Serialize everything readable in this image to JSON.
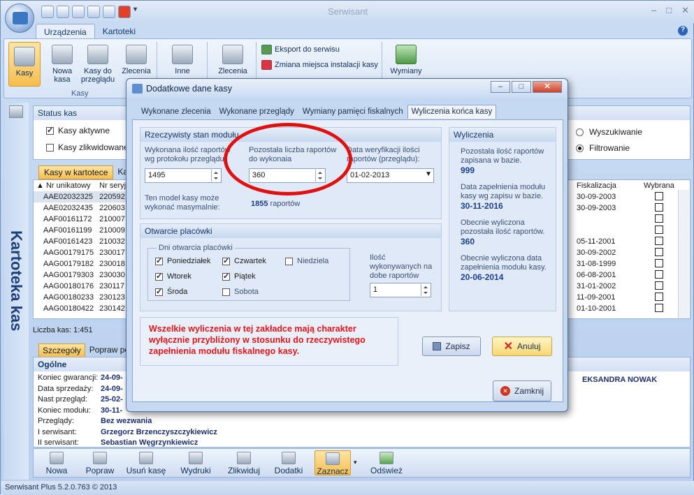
{
  "app": {
    "title": "Serwisant",
    "min": "–",
    "max": "□",
    "close": "✕"
  },
  "ribbon_tabs": [
    "Urządzenia",
    "Kartoteki"
  ],
  "ribbon": {
    "kasy": "Kasy",
    "nowa_kasa": "Nowa\nkasa",
    "kasy_przegladu": "Kasy do\nprzeglądu",
    "zlecenia": "Zlecenia",
    "group_kasy": "Kasy",
    "inne": "Inne",
    "zlecenia2": "Zlecenia",
    "eksport": "Eksport do serwisu",
    "zmiana": "Zmiana miejsca instalacji kasy",
    "wymiany": "Wymiany"
  },
  "side_title": "Kartoteka kas",
  "status_kas": {
    "title": "Status kas",
    "aktywne": "Kasy aktywne",
    "zlikwidowane": "Kasy zlikwidowane",
    "wyszukiwanie": "Wyszukiwanie",
    "filtrowanie": "Filtrowanie"
  },
  "list_tabs": [
    "Kasy w kartotece",
    "Kas"
  ],
  "grid": {
    "headers": [
      "Nr unikatowy",
      "Nr seryjny"
    ],
    "rows": [
      [
        "AAE02032325",
        "220592"
      ],
      [
        "AAE02032435",
        "220603"
      ],
      [
        "AAF00161172",
        "210007"
      ],
      [
        "AAF00161199",
        "210009"
      ],
      [
        "AAF00161423",
        "210032"
      ],
      [
        "AAG00179175",
        "230017"
      ],
      [
        "AAG00179182",
        "230018"
      ],
      [
        "AAG00179303",
        "230030"
      ],
      [
        "AAG00180176",
        "230117"
      ],
      [
        "AAG00180233",
        "230123"
      ],
      [
        "AAG00180422",
        "230142"
      ]
    ],
    "right_headers": [
      "Fiskalizacja",
      "Wybrana"
    ],
    "right_rows": [
      "30-09-2003",
      "30-09-2003",
      "",
      "",
      "05-11-2001",
      "30-09-2002",
      "31-08-1999",
      "06-08-2001",
      "31-01-2002",
      "11-09-2001",
      "01-10-2001"
    ]
  },
  "liczba_kas": "Liczba kas:   1:451",
  "detail_tabs": [
    "Szczegóły",
    "Popraw poda"
  ],
  "ogolne": {
    "title": "Ogólne",
    "rows": [
      [
        "Koniec gwarancji:",
        "24-09-"
      ],
      [
        "Data sprzedaży:",
        "24-09-"
      ],
      [
        "Nast przegląd:",
        "25-02-"
      ],
      [
        "Koniec modułu:",
        "30-11-"
      ],
      [
        "Przeglądy:",
        "Bez wezwania"
      ],
      [
        "I serwisant:",
        "Grzegorz Brzenczyszczykiewicz"
      ],
      [
        "II serwisant:",
        "Sebastian Węgrzynkiewicz"
      ]
    ]
  },
  "right_person": "EKSANDRA NOWAK",
  "bottom": [
    "Nowa",
    "Popraw",
    "Usuń kasę",
    "Wydruki",
    "Zlikwiduj",
    "Dodatki",
    "Zaznacz",
    "Odśwież"
  ],
  "statusbar": "Serwisant Plus 5.2.0.763 © 2013",
  "dialog": {
    "title": "Dodatkowe dane kasy",
    "tabs": [
      "Wykonane zlecenia",
      "Wykonane przeglądy",
      "Wymiany pamięci fiskalnych",
      "Wyliczenia końca kasy"
    ],
    "stan": {
      "title": "Rzeczywisty stan modułu",
      "wykonana_lbl": "Wykonana ilość raportów wg protokołu przeglądu",
      "wykonana_val": "1495",
      "pozostala_lbl": "Pozostała liczba raportów do wykonaia",
      "pozostala_val": "360",
      "data_lbl": "Data weryfikacji ilości raportów (przeglądu):",
      "data_val": "01-02-2013",
      "max_lbl": "Ten model kasy może wykonać masymalnie:",
      "max_val": "1855",
      "max_unit": "raportów"
    },
    "otwarcie": {
      "title": "Otwarcie placówki",
      "group": "Dni otwarcia placówki",
      "days": [
        [
          "Poniedziałek",
          true
        ],
        [
          "Czwartek",
          true
        ],
        [
          "Niedziela",
          false
        ],
        [
          "Wtorek",
          true
        ],
        [
          "Piątek",
          true
        ],
        [
          "Środa",
          true
        ],
        [
          "Sobota",
          false
        ]
      ],
      "ilosc_lbl": "Ilość wykonywanych na dobe raportów",
      "ilosc_val": "1"
    },
    "wyliczenia": {
      "title": "Wyliczenia",
      "items": [
        [
          "Pozostała ilość raportów zapisana w bazie.",
          "999"
        ],
        [
          "Data zapełnienia modułu kasy wg zapisu w bazie.",
          "30-11-2016"
        ],
        [
          "Obecnie wyliczona pozostała ilość raportów.",
          "360"
        ],
        [
          "Obecnie wyliczona data zapełnienia modułu kasy.",
          "20-06-2014"
        ]
      ]
    },
    "warning": "Wszelkie wyliczenia w tej zakładce mają charakter wyłącznie przybliżony w stosunku do rzeczywistego zapełnienia modułu fiskalnego kasy.",
    "zapisz": "Zapisz",
    "anuluj": "Anuluj",
    "zamknij": "Zamknij"
  },
  "colors": {
    "warning": "#e0141b",
    "highlight_ring": "#e01010",
    "accent": "#15386b"
  }
}
